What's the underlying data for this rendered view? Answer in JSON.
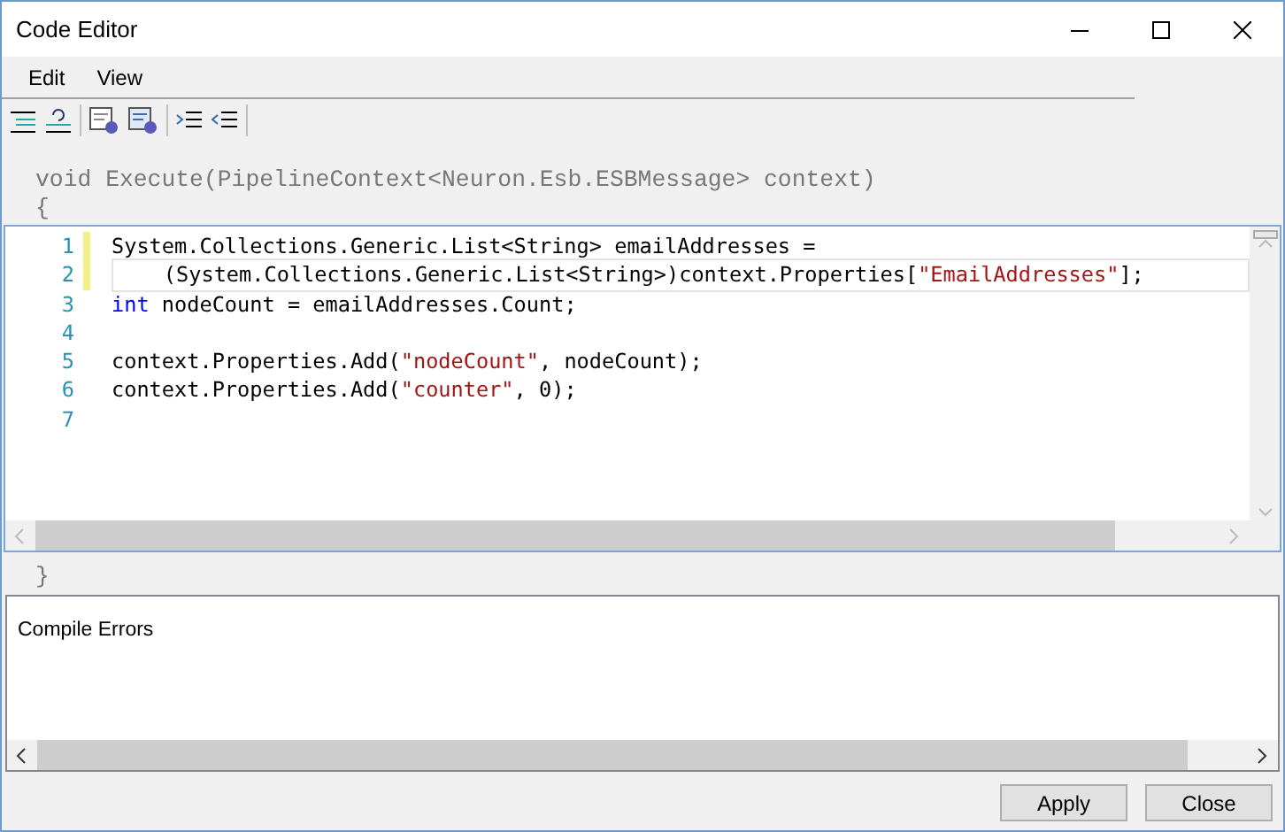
{
  "window": {
    "title": "Code Editor"
  },
  "menu": [
    "Edit",
    "View"
  ],
  "signature": "void Execute(PipelineContext<Neuron.Esb.ESBMessage> context)",
  "open_brace": "{",
  "code_lines": [
    {
      "number": "1",
      "modified": true,
      "current": false,
      "tokens": [
        {
          "kind": "plain",
          "text": "System.Collections.Generic.List<String> emailAddresses ="
        }
      ]
    },
    {
      "number": "2",
      "modified": true,
      "current": true,
      "tokens": [
        {
          "kind": "plain",
          "text": "    (System.Collections.Generic.List<String>)context.Properties["
        },
        {
          "kind": "string",
          "text": "\"EmailAddresses\""
        },
        {
          "kind": "plain",
          "text": "];"
        }
      ]
    },
    {
      "number": "3",
      "modified": false,
      "current": false,
      "tokens": [
        {
          "kind": "keyword",
          "text": "int"
        },
        {
          "kind": "plain",
          "text": " nodeCount = emailAddresses.Count;"
        }
      ]
    },
    {
      "number": "4",
      "modified": false,
      "current": false
    },
    {
      "number": "5",
      "modified": false,
      "current": false,
      "tokens": [
        {
          "kind": "plain",
          "text": "context.Properties.Add("
        },
        {
          "kind": "string",
          "text": "\"nodeCount\""
        },
        {
          "kind": "plain",
          "text": ", nodeCount);"
        }
      ]
    },
    {
      "number": "6",
      "modified": false,
      "current": false,
      "tokens": [
        {
          "kind": "plain",
          "text": "context.Properties.Add("
        },
        {
          "kind": "string",
          "text": "\"counter\""
        },
        {
          "kind": "plain",
          "text": ", 0);"
        }
      ]
    },
    {
      "number": "7",
      "modified": false,
      "current": false
    }
  ],
  "close_brace": "}",
  "compile_errors": {
    "label": "Compile Errors"
  },
  "buttons": [
    "Apply",
    "Close"
  ]
}
